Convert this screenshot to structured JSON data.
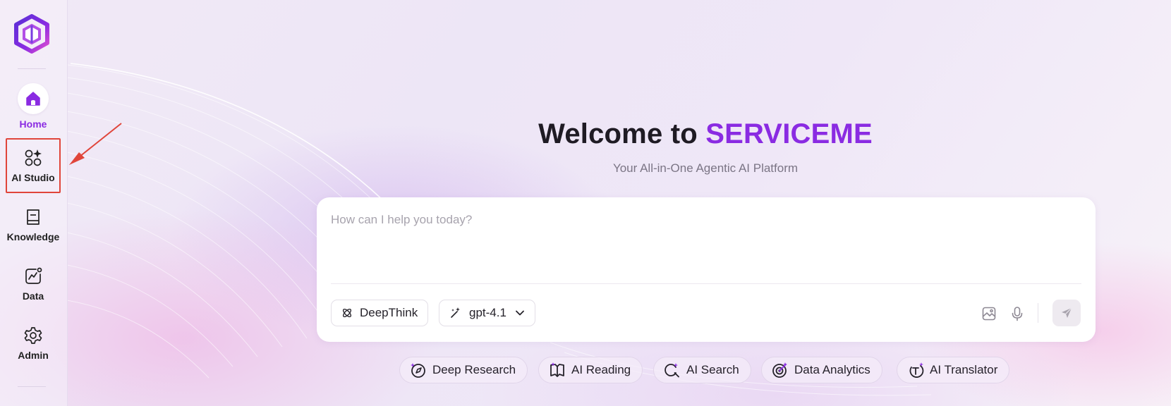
{
  "sidebar": {
    "logo_icon": "serviceme-logo-icon",
    "items": [
      {
        "label": "Home",
        "icon": "home-icon",
        "active": true
      },
      {
        "label": "AI Studio",
        "icon": "ai-studio-icon",
        "highlighted": true
      },
      {
        "label": "Knowledge",
        "icon": "book-icon"
      },
      {
        "label": "Data",
        "icon": "chart-icon"
      },
      {
        "label": "Admin",
        "icon": "gear-icon"
      }
    ]
  },
  "main": {
    "welcome_prefix": "Welcome to",
    "welcome_brand": "SERVICEME",
    "subtitle": "Your All-in-One Agentic AI Platform",
    "chat": {
      "placeholder": "How can I help you today?",
      "deepthink_label": "DeepThink",
      "model_label": "gpt-4.1",
      "tools": [
        "image-upload-icon",
        "microphone-icon",
        "send-icon"
      ]
    },
    "chips": [
      {
        "label": "Deep Research",
        "icon": "deep-research-icon"
      },
      {
        "label": "AI Reading",
        "icon": "ai-reading-icon"
      },
      {
        "label": "AI Search",
        "icon": "ai-search-icon"
      },
      {
        "label": "Data Analytics",
        "icon": "data-analytics-icon"
      },
      {
        "label": "AI Translator",
        "icon": "ai-translator-icon"
      }
    ]
  },
  "colors": {
    "accent": "#8a2be2",
    "highlight_border": "#e0453a",
    "text": "#1f1b24",
    "muted": "#7b7585"
  }
}
